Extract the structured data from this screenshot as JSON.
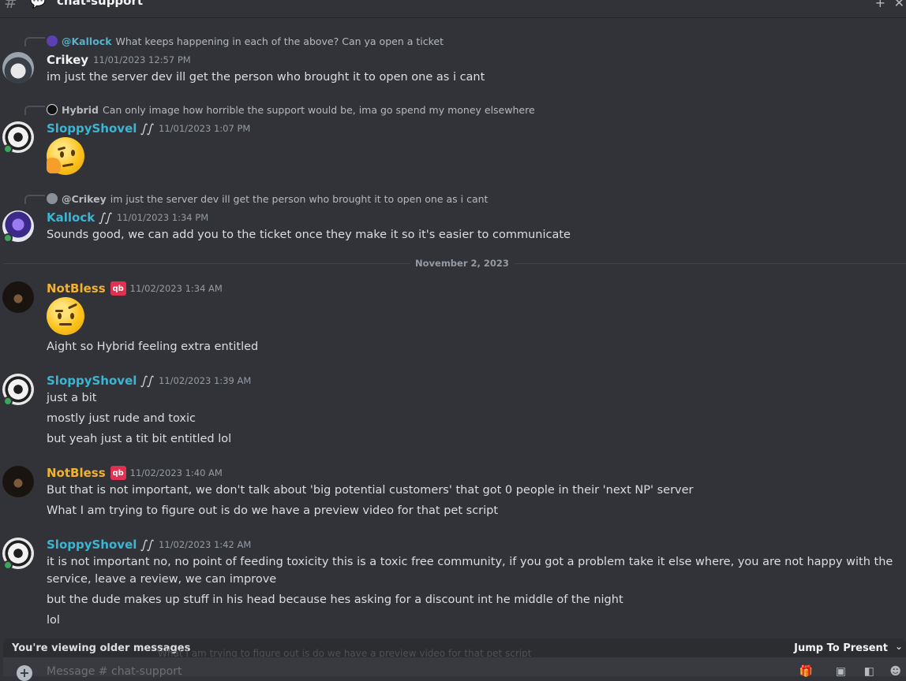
{
  "channel": {
    "name": "chat-support",
    "icon": "chat-bubble-icon"
  },
  "divider": "November 2, 2023",
  "messages": [
    {
      "reply": {
        "user": "@Kallock",
        "text": "What keeps happening in each of the above? Can ya open a ticket"
      },
      "user": "Crikey",
      "color": "#f2f3f5",
      "timestamp": "11/01/2023 12:57 PM",
      "lines": [
        "im just the server dev ill get the person who brought it to open one as i cant"
      ]
    },
    {
      "reply": {
        "user": "Hybrid",
        "text": "Can only image how horrible the support would be, ima go spend my money elsewhere"
      },
      "user": "SloppyShovel",
      "color": "#3cb4d2",
      "timestamp": "11/01/2023 1:07 PM",
      "emoji": "thinking-face"
    },
    {
      "reply": {
        "user": "@Crikey",
        "text": "im just the server dev ill get the person who brought it to open one as i cant"
      },
      "user": "Kallock",
      "color": "#3cb4d2",
      "timestamp": "11/01/2023 1:34 PM",
      "lines": [
        "Sounds good, we can add you to the ticket once they make it so it's easier to communicate"
      ]
    },
    {
      "user": "NotBless",
      "color": "#f0b232",
      "timestamp": "11/02/2023 1:34 AM",
      "badge": "qb",
      "emoji": "face-with-raised-eyebrow",
      "lines": [
        "Aight so Hybrid feeling extra entitled"
      ]
    },
    {
      "user": "SloppyShovel",
      "color": "#3cb4d2",
      "timestamp": "11/02/2023 1:39 AM",
      "lines": [
        "just a bit",
        "mostly just rude and toxic",
        "but yeah just a tit bit entitled lol"
      ]
    },
    {
      "user": "NotBless",
      "color": "#f0b232",
      "timestamp": "11/02/2023 1:40 AM",
      "badge": "qb",
      "lines": [
        "But that is not important, we don't talk about 'big potential customers' that got 0 people in their 'next NP' server",
        "What I am trying to figure out is do we have a preview video for that pet script"
      ]
    },
    {
      "user": "SloppyShovel",
      "color": "#3cb4d2",
      "timestamp": "11/02/2023 1:42 AM",
      "lines": [
        "it is not important no, no point of feeding toxicity this is a toxic free community, if you got a problem take it else where, you are not happy with the service, leave a review, we can improve",
        "but the dude makes up stuff in his head because hes asking for a discount int he middle of the night",
        "lol"
      ]
    }
  ],
  "older_bar": {
    "label": "You're viewing older messages",
    "jump": "Jump To Present"
  },
  "ghost_text": "What I am trying to figure out is do we have a preview video for that pet script",
  "composer": {
    "placeholder": "Message #  chat-support"
  }
}
